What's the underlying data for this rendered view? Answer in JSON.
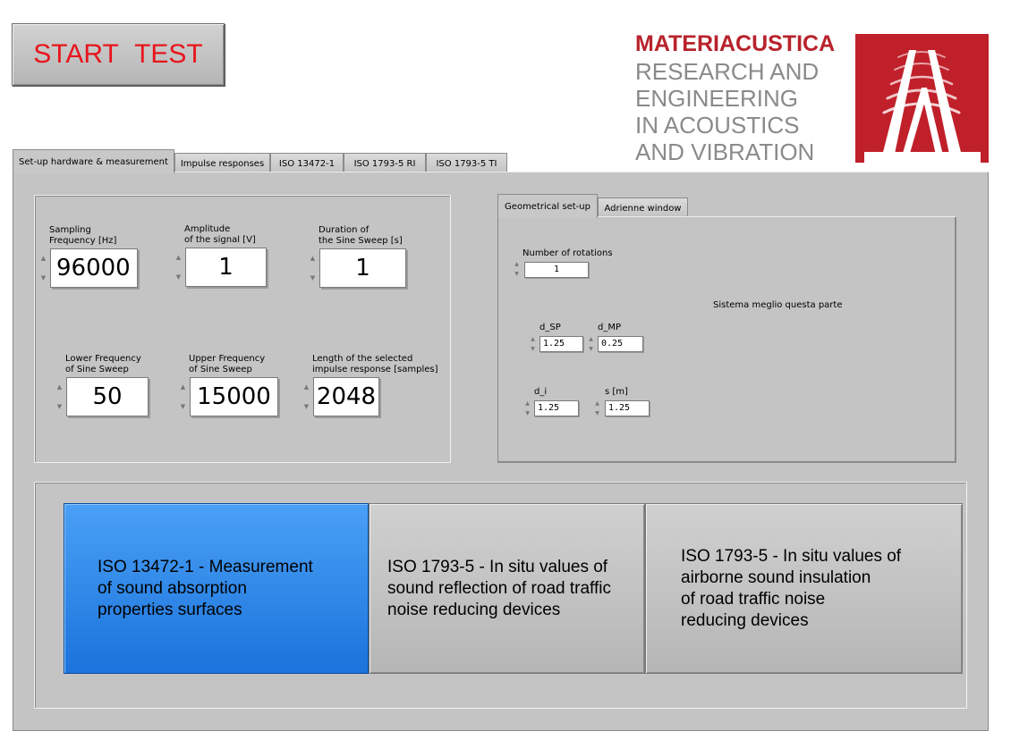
{
  "start_button": {
    "label": "START  TEST"
  },
  "logo": {
    "title": "MATERIACUSTICA",
    "lines": [
      "RESEARCH AND",
      "ENGINEERING",
      "IN ACOUSTICS",
      "AND VIBRATION"
    ],
    "brand_color": "#c0202a"
  },
  "tabs": [
    {
      "label": "Set-up hardware & measurement",
      "active": true
    },
    {
      "label": "Impulse responses"
    },
    {
      "label": "ISO 13472-1"
    },
    {
      "label": "ISO 1793-5  RI"
    },
    {
      "label": "ISO 1793-5  TI"
    }
  ],
  "measurement": {
    "sampling": {
      "label1": "Sampling",
      "label2": "Frequency [Hz]",
      "value": "96000"
    },
    "amplitude": {
      "label1": "Amplitude",
      "label2": "of the signal [V]",
      "value": "1"
    },
    "duration": {
      "label1": "Duration of",
      "label2": "the Sine Sweep [s]",
      "value": "1"
    },
    "lower": {
      "label1": "Lower Frequency",
      "label2": "of Sine Sweep",
      "value": "50"
    },
    "upper": {
      "label1": "Upper Frequency",
      "label2": "of Sine Sweep",
      "value": "15000"
    },
    "length": {
      "label1": "Length of the selected",
      "label2": "impulse response [samples]",
      "value": "2048"
    }
  },
  "inner_tabs": [
    {
      "label": "Geometrical set-up",
      "active": true
    },
    {
      "label": "Adrienne window"
    }
  ],
  "geometry": {
    "rotations": {
      "label": "Number of rotations",
      "value": "1"
    },
    "note": "Sistema meglio questa parte",
    "d_sp": {
      "label": "d_SP",
      "value": "1.25"
    },
    "d_mp": {
      "label": "d_MP",
      "value": "0.25"
    },
    "d_i": {
      "label": "d_i",
      "value": "1.25"
    },
    "s": {
      "label": "s [m]",
      "value": "1.25"
    }
  },
  "standards": [
    {
      "label": "ISO 13472-1  - Measurement\nof sound absorption\nproperties surfaces",
      "selected": true
    },
    {
      "label": "ISO 1793-5  - In situ values of\nsound reflection of road traffic\nnoise reducing devices"
    },
    {
      "label": "ISO 1793-5  - In situ values of\nairborne sound insulation\nof road traffic noise\nreducing devices"
    }
  ],
  "colors": {
    "accent_blue": "#1b73dc",
    "start_text": "#e8141b",
    "panel": "#c4c4c4"
  }
}
